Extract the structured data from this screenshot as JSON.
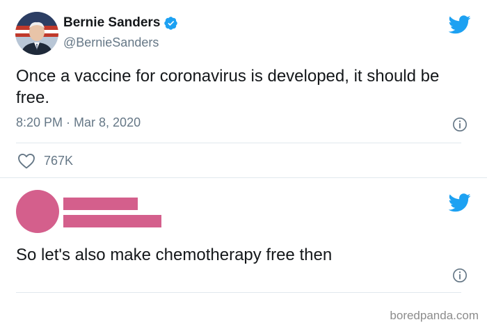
{
  "tweet1": {
    "display_name": "Bernie Sanders",
    "handle": "@BernieSanders",
    "text": "Once a vaccine for coronavirus is developed, it should be free.",
    "timestamp": "8:20 PM · Mar 8, 2020",
    "likes": "767K"
  },
  "tweet2": {
    "text": "So let's also make chemotherapy free then"
  },
  "watermark": "boredpanda.com",
  "colors": {
    "twitter_blue": "#1da1f2",
    "redaction_pink": "#d45f8c",
    "secondary_text": "#657786"
  },
  "icons": {
    "brand": "twitter-bird-icon",
    "verified": "verified-badge-icon",
    "info": "info-icon",
    "like": "heart-icon"
  }
}
